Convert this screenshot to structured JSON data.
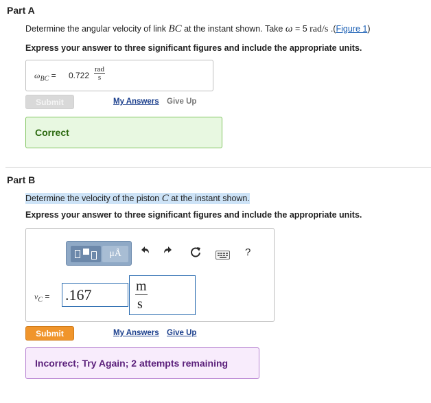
{
  "partA": {
    "title": "Part A",
    "question": {
      "prefix": "Determine the angular velocity of link ",
      "link_var": "BC",
      "mid": " at the instant shown. Take ",
      "omega": "ω",
      "equals": " = 5 ",
      "unit": "rad/s",
      "dot": " .(",
      "figure_link": "Figure 1",
      "close": ")"
    },
    "instruction": "Express your answer to three significant figures and include the appropriate units.",
    "answer": {
      "label_sym": "ω",
      "label_sub": "BC",
      "eq": " = ",
      "value": "0.722",
      "unit_num": "rad",
      "unit_den": "s"
    },
    "submit_label": "Submit",
    "my_answers_label": "My Answers",
    "give_up_label": "Give Up",
    "feedback": "Correct"
  },
  "partB": {
    "title": "Part B",
    "question": {
      "prefix": "Determine the velocity of the piston ",
      "var": "C",
      "suffix": " at the instant shown."
    },
    "instruction": "Express your answer to three significant figures and include the appropriate units.",
    "toolbar": {
      "units_button": "μÅ",
      "help": "?"
    },
    "answer": {
      "label_sym": "v",
      "label_sub": "C",
      "eq": " = ",
      "value": ".167",
      "unit_num": "m",
      "unit_den": "s"
    },
    "submit_label": "Submit",
    "my_answers_label": "My Answers",
    "give_up_label": "Give Up",
    "feedback": "Incorrect; Try Again; 2 attempts remaining"
  },
  "colors": {
    "correct_bg": "#e8f8e1",
    "correct_border": "#7fc45e",
    "incorrect_bg": "#f8ecfc",
    "incorrect_border": "#b57ed0",
    "submit_active": "#f0952c",
    "link": "#1a3e8c",
    "highlight": "#cde3f7"
  }
}
